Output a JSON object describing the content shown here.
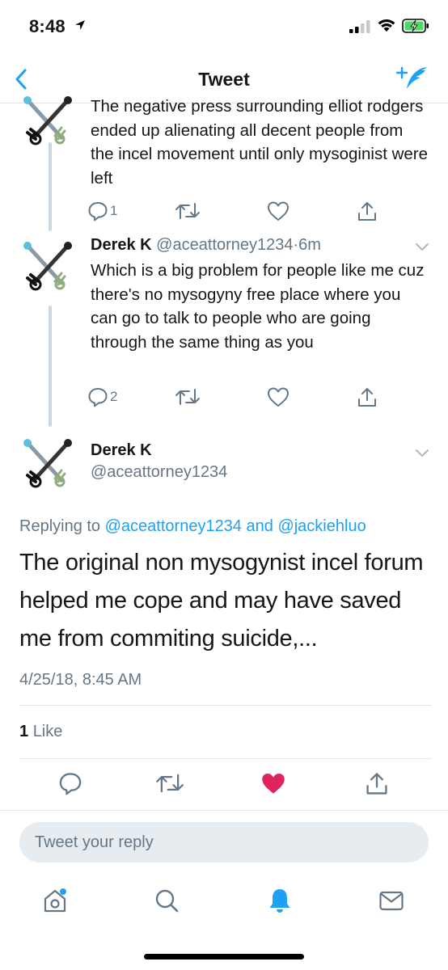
{
  "status_bar": {
    "time": "8:48"
  },
  "nav": {
    "title": "Tweet"
  },
  "thread": [
    {
      "text": "The negative press surrounding elliot rodgers ended up alienating all decent people from the incel movement until only mysoginist were left",
      "reply_count": "1",
      "icons": [
        "reply-icon",
        "retweet-icon",
        "like-icon",
        "share-icon"
      ]
    },
    {
      "name": "Derek K",
      "handle": "@aceattorney1234",
      "separator": "·",
      "time": "6m",
      "text": "Which is a big problem for people like me cuz there's no mysogyny free place where you can go to talk to people who are going through the same thing as you",
      "reply_count": "2"
    }
  ],
  "main_tweet": {
    "name": "Derek K",
    "handle": "@aceattorney1234",
    "replying_prefix": "Replying to",
    "replying_user1": "@aceattorney1234",
    "replying_and": "and",
    "replying_user2": "@jackiehluo",
    "text": "The original non mysogynist incel forum helped me cope and may have saved me from commiting suicide,...",
    "timestamp": "4/25/18, 8:45 AM",
    "like_count": "1",
    "like_label": "Like",
    "liked": true
  },
  "reply_bar": {
    "placeholder": "Tweet your reply"
  },
  "tabbar": {
    "items": [
      "home-icon",
      "search-icon",
      "notifications-icon",
      "messages-icon"
    ],
    "active": "notifications-icon"
  },
  "colors": {
    "accent": "#1da1f2",
    "like": "#e0245e",
    "muted": "#657786",
    "divider": "#e1e8ed"
  }
}
